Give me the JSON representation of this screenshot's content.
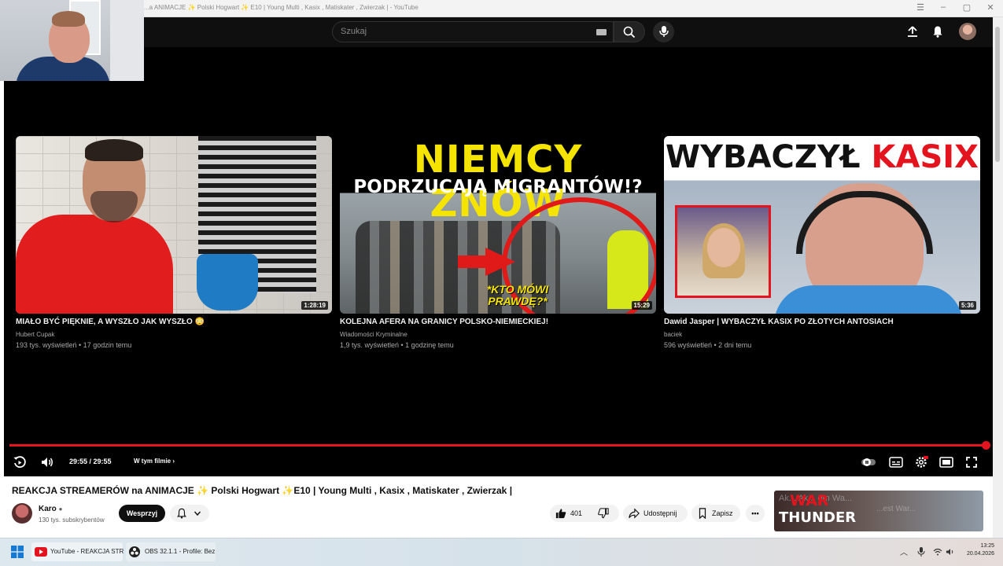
{
  "browser": {
    "tab_title": "...a ANIMACJE ✨ Polski Hogwart ✨ E10 | Young Multi , Kasix , Matiskater , Zwierzak | - YouTube"
  },
  "header": {
    "search_placeholder": "Szukaj"
  },
  "end_screen": {
    "cards": [
      {
        "title": "MIAŁO BYĆ PIĘKNIE, A WYSZŁO JAK WYSZŁO 😳",
        "channel": "Hubert Cupak",
        "meta": "193 tys. wyświetleń • 17 godzin temu",
        "duration": "1:28:19"
      },
      {
        "title": "KOLEJNA AFERA NA GRANICY POLSKO-NIEMIECKIEJ!",
        "channel": "Wiadomości Kryminalne",
        "meta": "1,9 tys. wyświetleń • 1 godzinę temu",
        "duration": "15:29",
        "thumb_line1": "NIEMCY ZNÓW",
        "thumb_line2": "PODRZUCAJĄ MIGRANTÓW!?",
        "thumb_caption": "*KTO MÓWI PRAWDĘ?*"
      },
      {
        "title": "Dawid Jasper | WYBACZYŁ KASIX PO ZŁOTYCH ANTOSIACH",
        "channel": "baciek",
        "meta": "596 wyświetleń • 2 dni temu",
        "duration": "5:36",
        "thumb_word1": "WYBACZYŁ",
        "thumb_word2": "KASIX"
      }
    ]
  },
  "player": {
    "time": "29:55 / 29:55",
    "chapters_label": "W tym filmie",
    "progress": 1.0,
    "accent": "#e3141e"
  },
  "video": {
    "title": "REAKCJA STREAMERÓW na ANIMACJE ✨ Polski Hogwart ✨E10 | Young Multi , Kasix , Matiskater , Zwierzak |",
    "channel": "Karo",
    "subscribers": "130 tys. subskrybentów",
    "support_label": "Wesprzyj",
    "likes": "401",
    "share_label": "Udostępnij",
    "save_label": "Zapisz"
  },
  "ad": {
    "brand_top": "WAR",
    "brand_bottom": "THUNDER",
    "ghost_text": "Ak... Ak... em Wa...",
    "ghost_text2": "...est War..."
  },
  "taskbar": {
    "apps": [
      {
        "label": "YouTube - REAKCJA STR",
        "icon": "youtube-icon"
      },
      {
        "label": "OBS 32.1.1 - Profile: Bez",
        "icon": "obs-icon"
      }
    ],
    "time": "13:25",
    "date": "20.04.2026"
  }
}
